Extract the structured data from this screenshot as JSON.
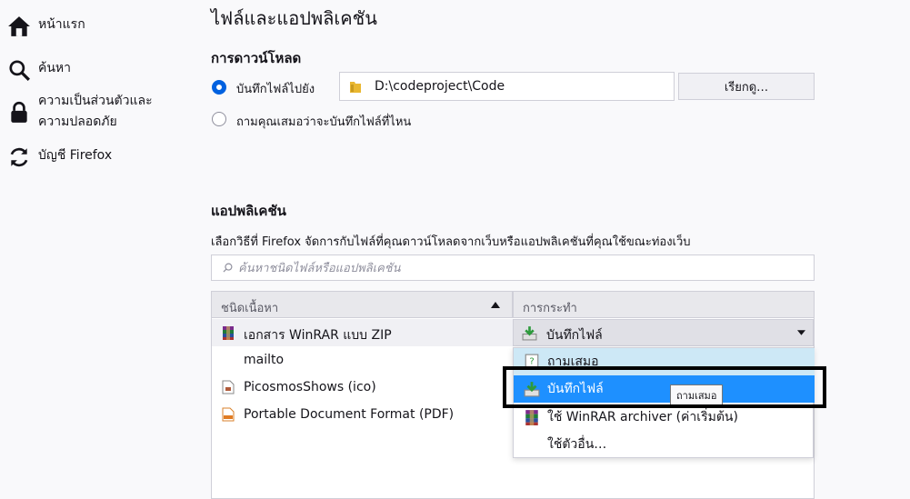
{
  "sidebar": {
    "items": [
      {
        "label": "หน้าแรก",
        "icon": "home-icon"
      },
      {
        "label": "ค้นหา",
        "icon": "search-icon"
      },
      {
        "label_line1": "ความเป็นส่วนตัวและ",
        "label_line2": "ความปลอดภัย",
        "icon": "lock-icon"
      },
      {
        "label": "บัญชี Firefox",
        "icon": "sync-icon"
      }
    ]
  },
  "main": {
    "title": "ไฟล์และแอปพลิเคชัน",
    "downloads": {
      "heading": "การดาวน์โหลด",
      "save_to_label": "บันทึกไฟล์ไปยัง",
      "save_path": "D:\\codeproject\\Code",
      "browse_button": "เรียกดู…",
      "always_ask_label": "ถามคุณเสมอว่าจะบันทึกไฟล์ที่ไหน"
    },
    "applications": {
      "heading": "แอปพลิเคชัน",
      "description": "เลือกวิธีที่ Firefox จัดการกับไฟล์ที่คุณดาวน์โหลดจากเว็บหรือแอปพลิเคชันที่คุณใช้ขณะท่องเว็บ",
      "search_placeholder": "ค้นหาชนิดไฟล์หรือแอปพลิเคชัน",
      "columns": {
        "content_type": "ชนิดเนื้อหา",
        "action": "การกระทำ"
      },
      "rows": [
        {
          "type": "เอกสาร WinRAR แบบ ZIP",
          "action": "บันทึกไฟล์",
          "icon": "winrar-icon"
        },
        {
          "type": "mailto",
          "action": "",
          "icon": ""
        },
        {
          "type": "PicosmosShows (ico)",
          "action": "",
          "icon": "file-icon"
        },
        {
          "type": "Portable Document Format (PDF)",
          "action": "",
          "icon": "pdf-icon"
        }
      ],
      "dropdown": {
        "options": [
          {
            "label": "ถามเสมอ",
            "icon": "ask-icon"
          },
          {
            "label": "บันทึกไฟล์",
            "icon": "save-file-icon"
          },
          {
            "label": "ใช้ WinRAR archiver (ค่าเริ่มต้น)",
            "icon": "winrar-icon"
          },
          {
            "label": "ใช้ตัวอื่น…",
            "icon": ""
          }
        ],
        "tooltip": "ถามเสมอ"
      }
    }
  },
  "colors": {
    "accent": "#0061e0",
    "highlight": "#1e90ff",
    "hover": "#cde8f6",
    "annotation_box": "#000000"
  }
}
